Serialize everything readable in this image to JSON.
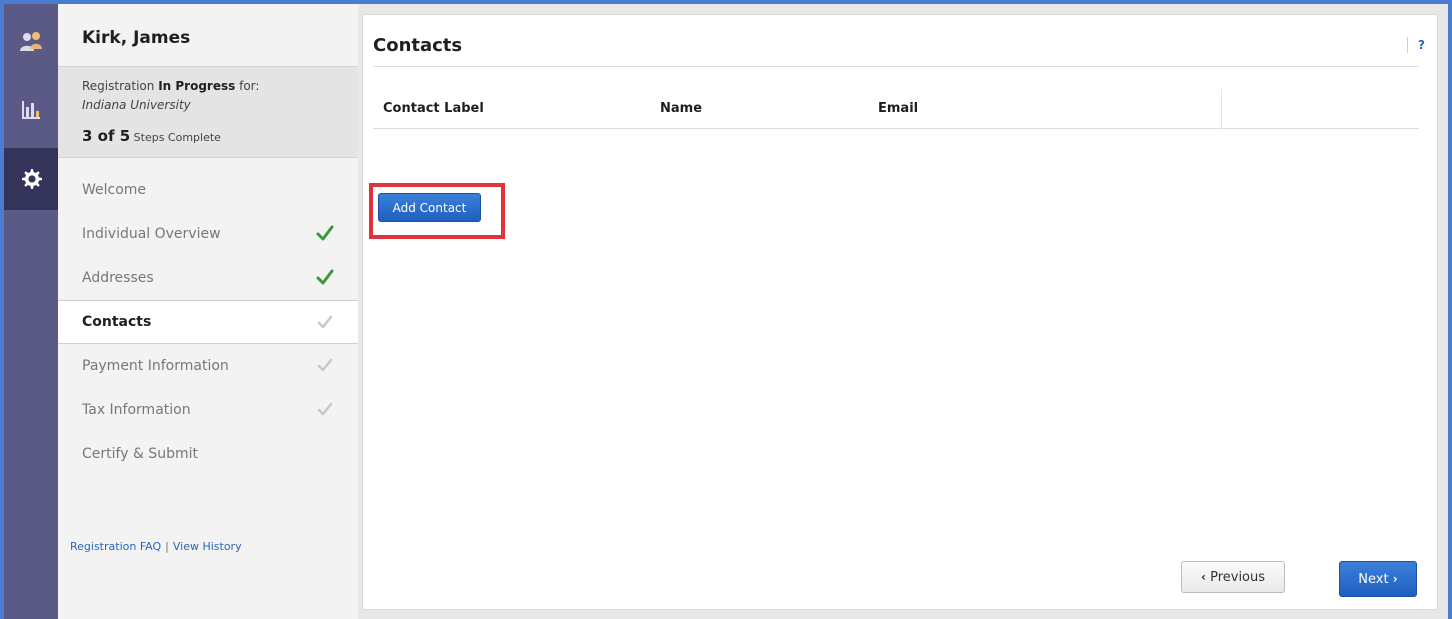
{
  "rail": {
    "items": [
      {
        "icon": "user-group-icon",
        "active": false
      },
      {
        "icon": "bar-chart-icon",
        "active": false
      },
      {
        "icon": "gear-icon",
        "active": true
      }
    ]
  },
  "sidebar": {
    "name": "Kirk, James",
    "status": {
      "prefix": "Registration",
      "state": "In Progress",
      "suffix": "for:",
      "organization": "Indiana University",
      "progress": "3 of 5",
      "progress_suffix": "Steps Complete"
    },
    "steps": [
      {
        "label": "Welcome",
        "check": "none"
      },
      {
        "label": "Individual Overview",
        "check": "complete"
      },
      {
        "label": "Addresses",
        "check": "complete"
      },
      {
        "label": "Contacts",
        "check": "pending",
        "current": true
      },
      {
        "label": "Payment Information",
        "check": "pending"
      },
      {
        "label": "Tax Information",
        "check": "pending"
      },
      {
        "label": "Certify & Submit",
        "check": "none"
      }
    ],
    "links": {
      "faq": "Registration FAQ",
      "separator": "|",
      "history": "View History"
    }
  },
  "main": {
    "title": "Contacts",
    "help": "?",
    "table": {
      "headers": [
        "Contact Label",
        "Name",
        "Email"
      ]
    },
    "add_button": "Add Contact",
    "prev_button": "Previous",
    "next_button": "Next"
  },
  "colors": {
    "rail": "#5b5a87",
    "rail_active": "#34335a",
    "primary": "#2a66b8",
    "check_complete": "#3a9a3a",
    "check_pending": "#c8c8c8",
    "highlight": "#e0343a"
  }
}
